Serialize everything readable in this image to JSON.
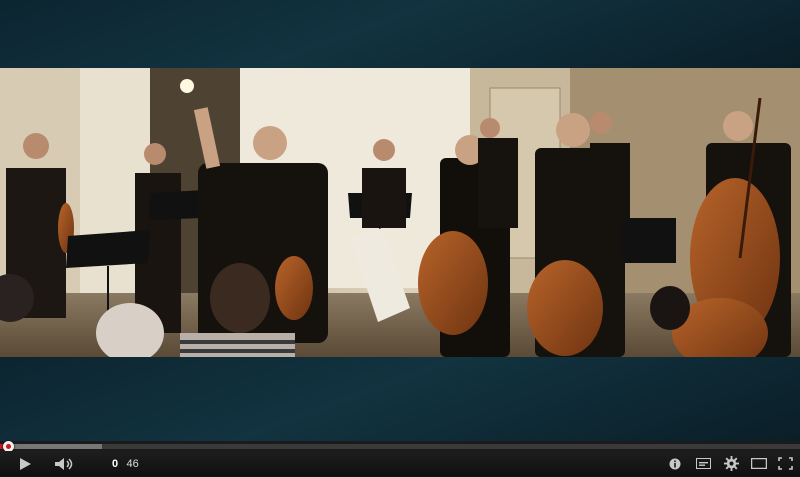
{
  "player": {
    "current_time": "0",
    "duration": "46",
    "progress_played": 0.006,
    "progress_loaded": 0.127
  },
  "controls": {
    "play_icon": "play-icon",
    "volume_icon": "volume-icon",
    "info_icon": "info-icon",
    "captions_icon": "captions-icon",
    "settings_icon": "gear-icon",
    "theater_icon": "theater-mode-icon",
    "fullscreen_icon": "fullscreen-icon"
  },
  "colors": {
    "accent": "#cc181e",
    "frame_bg": "#0c2530"
  }
}
